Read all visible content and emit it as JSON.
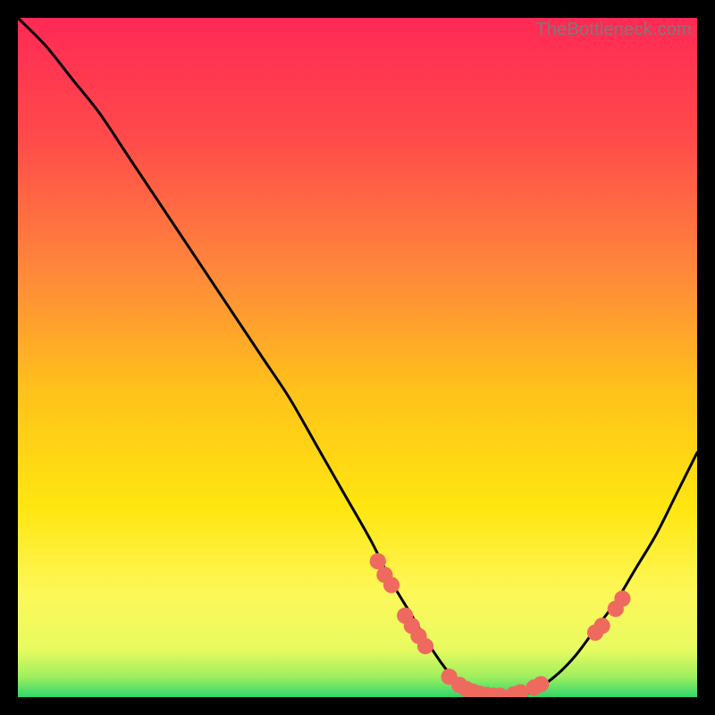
{
  "watermark": "TheBottleneck.com",
  "chart_data": {
    "type": "line",
    "title": "",
    "xlabel": "",
    "ylabel": "",
    "xlim": [
      0,
      100
    ],
    "ylim": [
      0,
      100
    ],
    "grid": false,
    "legend": false,
    "background_gradient": {
      "top": "#ff2955",
      "mid_upper": "#ff823f",
      "mid": "#ffd313",
      "mid_lower": "#fff658",
      "bottom": "#30d66c"
    },
    "series": [
      {
        "name": "bottleneck-curve",
        "color": "#000000",
        "x": [
          0,
          4,
          8,
          12,
          16,
          20,
          24,
          28,
          32,
          36,
          40,
          44,
          48,
          52,
          55,
          58,
          61,
          64,
          67,
          70,
          73,
          76,
          79,
          82,
          85,
          88,
          91,
          94,
          97,
          100
        ],
        "y": [
          100,
          96,
          91,
          86,
          80,
          74,
          68,
          62,
          56,
          50,
          44,
          37,
          30,
          23,
          17,
          12,
          7,
          3,
          1,
          0,
          0,
          1,
          3,
          6,
          10,
          14,
          19,
          24,
          30,
          36
        ]
      }
    ],
    "markers": {
      "name": "highlight-points",
      "color": "#ee6a5f",
      "radius_pct": 1.2,
      "points": [
        {
          "x": 53,
          "y": 20
        },
        {
          "x": 54,
          "y": 18
        },
        {
          "x": 55,
          "y": 16.5
        },
        {
          "x": 57,
          "y": 12
        },
        {
          "x": 58,
          "y": 10.5
        },
        {
          "x": 59,
          "y": 9
        },
        {
          "x": 60,
          "y": 7.5
        },
        {
          "x": 63.5,
          "y": 3
        },
        {
          "x": 65,
          "y": 1.8
        },
        {
          "x": 66,
          "y": 1.2
        },
        {
          "x": 67,
          "y": 0.8
        },
        {
          "x": 68,
          "y": 0.5
        },
        {
          "x": 69,
          "y": 0.3
        },
        {
          "x": 70,
          "y": 0.2
        },
        {
          "x": 71,
          "y": 0.2
        },
        {
          "x": 73,
          "y": 0.4
        },
        {
          "x": 74,
          "y": 0.7
        },
        {
          "x": 76,
          "y": 1.4
        },
        {
          "x": 77,
          "y": 1.9
        },
        {
          "x": 85,
          "y": 9.5
        },
        {
          "x": 86,
          "y": 10.5
        },
        {
          "x": 88,
          "y": 13
        },
        {
          "x": 89,
          "y": 14.5
        }
      ]
    }
  }
}
